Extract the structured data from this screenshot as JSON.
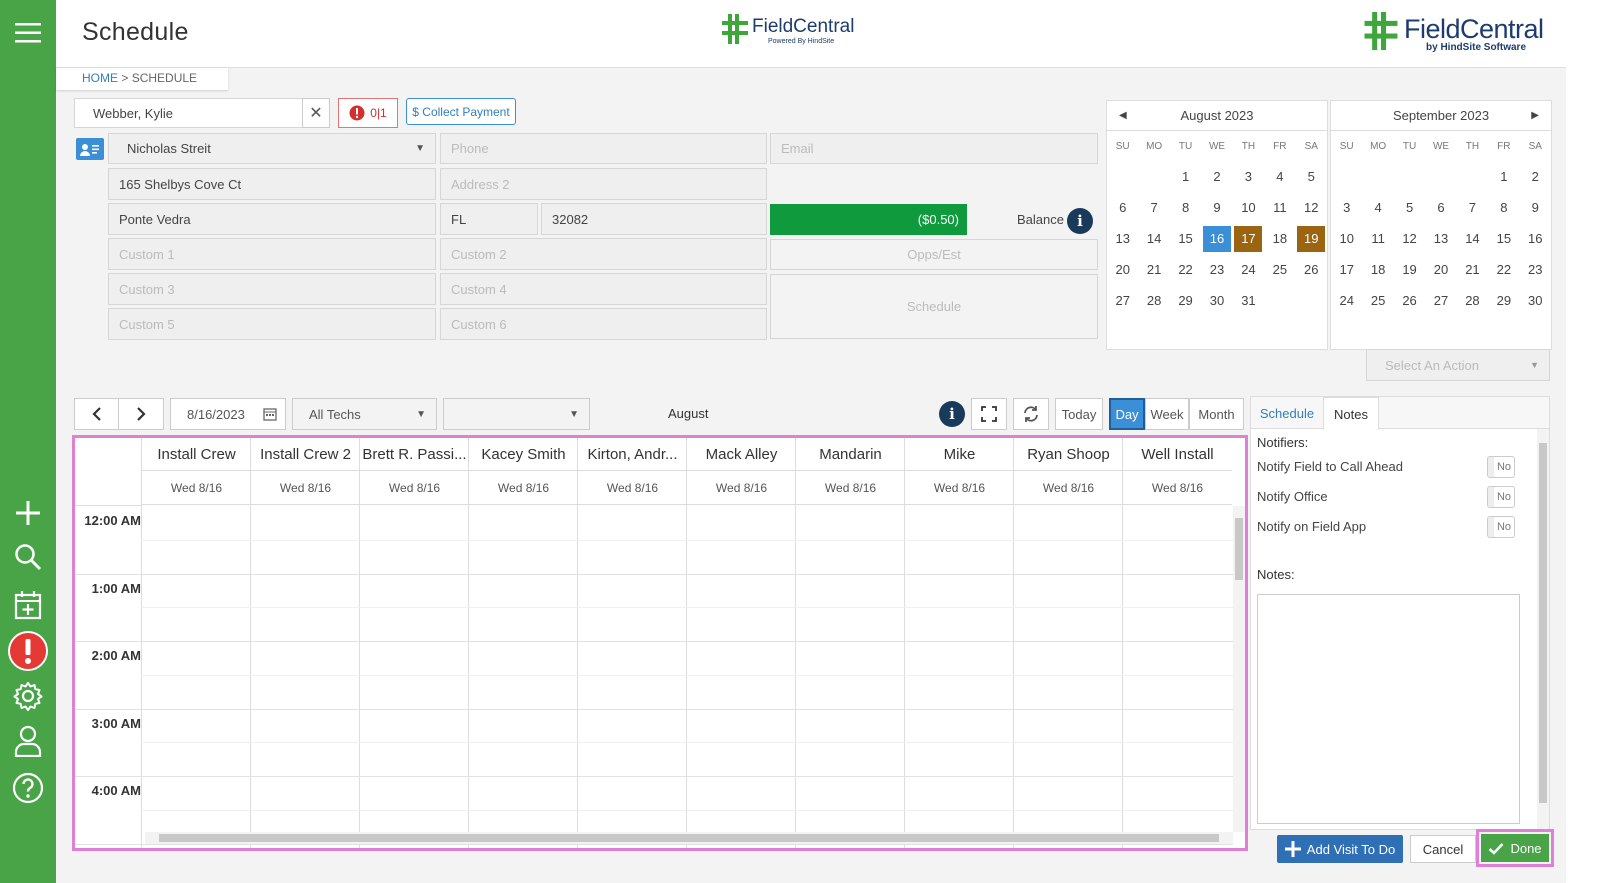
{
  "app": {
    "title": "Schedule",
    "logo_small": "FieldCentral",
    "logo_small_sub": "Powered By HindSite",
    "logo_big": "FieldCentral",
    "logo_big_sub": "by HindSite Software"
  },
  "breadcrumb": {
    "home": "HOME",
    "sep": ">",
    "current": "SCHEDULE"
  },
  "sidebar": {
    "icons": [
      "menu-icon",
      "plus-icon",
      "search-icon",
      "calendar-add-icon",
      "alert-icon",
      "gear-icon",
      "user-icon",
      "help-icon"
    ]
  },
  "customer": {
    "name": "Webber, Kylie",
    "alerts": "0|1",
    "collect_payment": "$ Collect Payment",
    "contact": "Nicholas Streit",
    "phone_ph": "Phone",
    "email_ph": "Email",
    "address1": "165 Shelbys Cove Ct",
    "address2_ph": "Address 2",
    "city": "Ponte Vedra",
    "state": "FL",
    "zip": "32082",
    "balance_value": "($0.50)",
    "balance_label": "Balance",
    "custom1": "Custom 1",
    "custom2": "Custom 2",
    "custom3": "Custom 3",
    "custom4": "Custom 4",
    "custom5": "Custom 5",
    "custom6": "Custom 6",
    "opps": "Opps/Est",
    "schedule": "Schedule"
  },
  "calendars": [
    {
      "title": "August 2023",
      "dow": [
        "SU",
        "MO",
        "TU",
        "WE",
        "TH",
        "FR",
        "SA"
      ],
      "weeks": [
        [
          "",
          "",
          "1",
          "2",
          "3",
          "4",
          "5"
        ],
        [
          "6",
          "7",
          "8",
          "9",
          "10",
          "11",
          "12"
        ],
        [
          "13",
          "14",
          "15",
          "16",
          "17",
          "18",
          "19"
        ],
        [
          "20",
          "21",
          "22",
          "23",
          "24",
          "25",
          "26"
        ],
        [
          "27",
          "28",
          "29",
          "30",
          "31",
          "",
          ""
        ]
      ],
      "highlight": {
        "16": "#3b8fd6",
        "17": "#9a6410",
        "19": "#9a6410"
      }
    },
    {
      "title": "September 2023",
      "dow": [
        "SU",
        "MO",
        "TU",
        "WE",
        "TH",
        "FR",
        "SA"
      ],
      "weeks": [
        [
          "",
          "",
          "",
          "",
          "",
          "1",
          "2"
        ],
        [
          "3",
          "4",
          "5",
          "6",
          "7",
          "8",
          "9"
        ],
        [
          "10",
          "11",
          "12",
          "13",
          "14",
          "15",
          "16"
        ],
        [
          "17",
          "18",
          "19",
          "20",
          "21",
          "22",
          "23"
        ],
        [
          "24",
          "25",
          "26",
          "27",
          "28",
          "29",
          "30"
        ]
      ],
      "highlight": {}
    }
  ],
  "select_action": "Select An Action",
  "toolbar": {
    "date": "8/16/2023",
    "techs": "All Techs",
    "second": "",
    "month_label": "August",
    "today": "Today",
    "day": "Day",
    "week": "Week",
    "month": "Month"
  },
  "schedule": {
    "columns": [
      {
        "name": "Install Crew",
        "date": "Wed 8/16"
      },
      {
        "name": "Install Crew 2",
        "date": "Wed 8/16"
      },
      {
        "name": "Brett R. Passi...",
        "date": "Wed 8/16"
      },
      {
        "name": "Kacey Smith",
        "date": "Wed 8/16"
      },
      {
        "name": "Kirton, Andr...",
        "date": "Wed 8/16"
      },
      {
        "name": "Mack Alley",
        "date": "Wed 8/16"
      },
      {
        "name": "Mandarin",
        "date": "Wed 8/16"
      },
      {
        "name": "Mike",
        "date": "Wed 8/16"
      },
      {
        "name": "Ryan Shoop",
        "date": "Wed 8/16"
      },
      {
        "name": "Well Install",
        "date": "Wed 8/16"
      }
    ],
    "times": [
      "12:00 AM",
      "1:00 AM",
      "2:00 AM",
      "3:00 AM",
      "4:00 AM"
    ]
  },
  "panel": {
    "tabs": [
      "Schedule",
      "Notes"
    ],
    "notifiers_label": "Notifiers:",
    "notifiers": [
      {
        "label": "Notify Field to Call Ahead",
        "value": "No"
      },
      {
        "label": "Notify Office",
        "value": "No"
      },
      {
        "label": "Notify on Field App",
        "value": "No"
      }
    ],
    "notes_label": "Notes:",
    "notes_value": ""
  },
  "footer": {
    "add_visit": "Add Visit To Do",
    "cancel": "Cancel",
    "done": "Done"
  },
  "colors": {
    "green": "#48a447",
    "blue": "#3b8fd6",
    "gold": "#9a6410",
    "balance": "#0e9a3d",
    "highlight": "#e07fd6"
  }
}
